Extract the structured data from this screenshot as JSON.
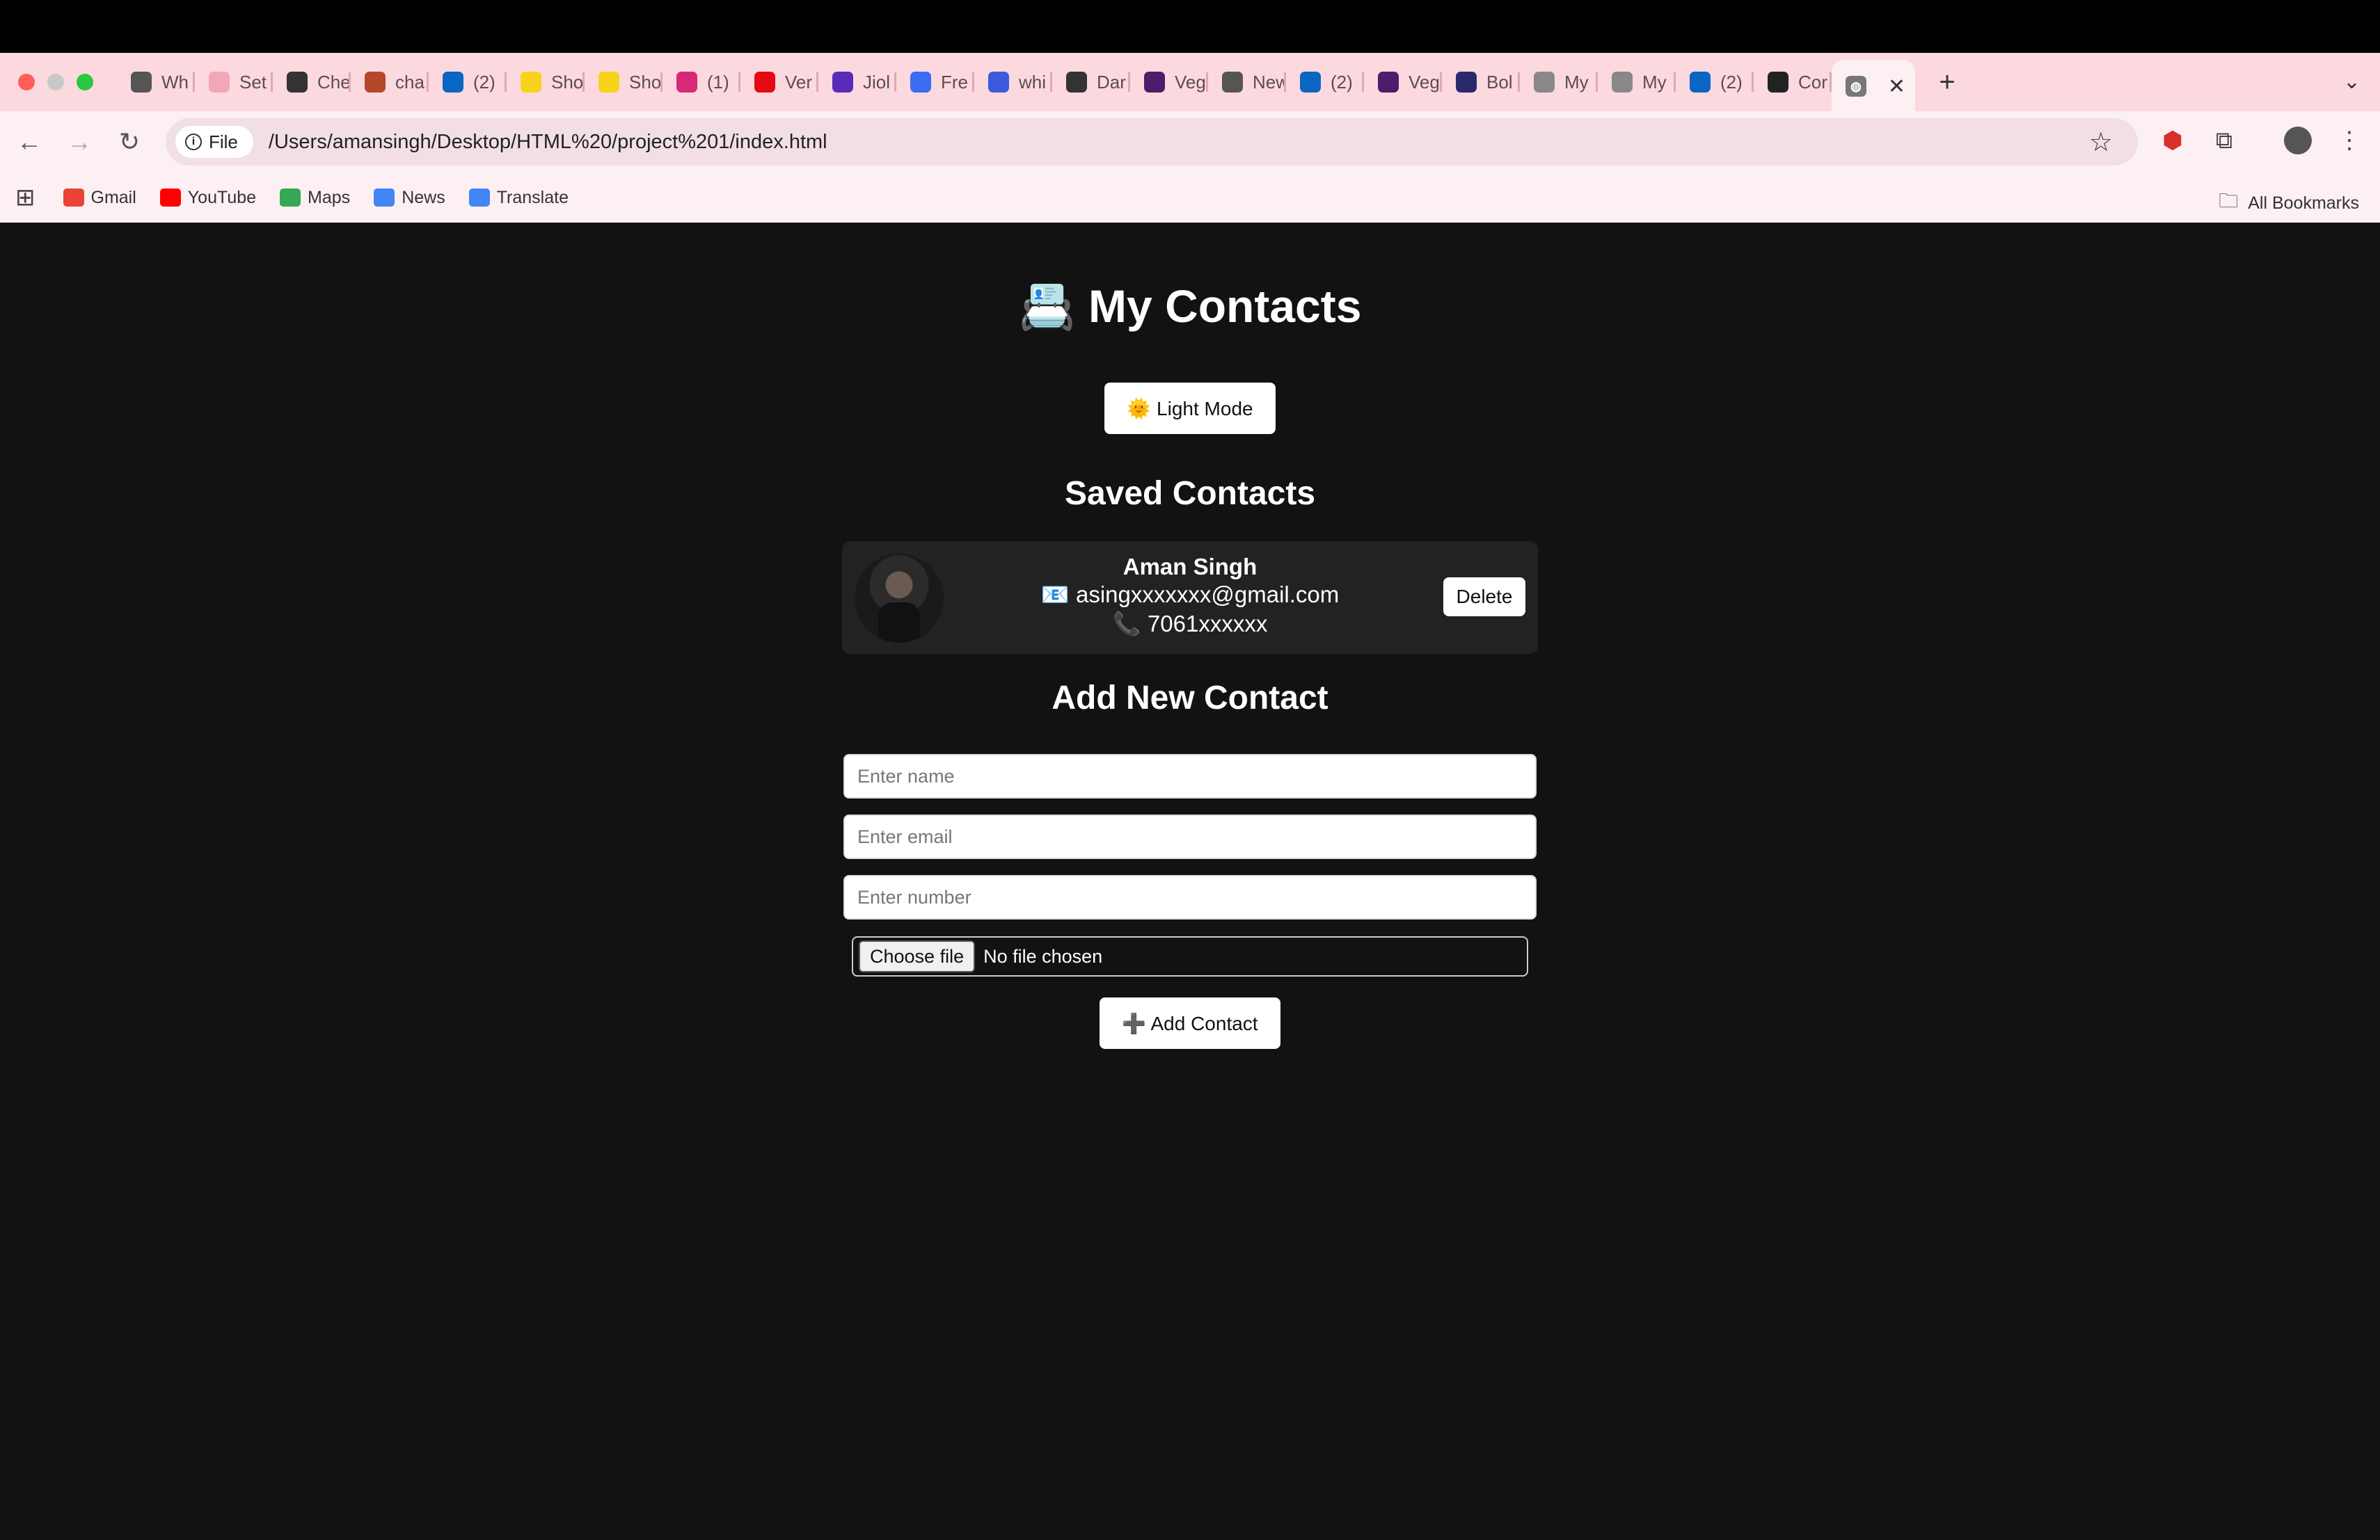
{
  "browser": {
    "tabs": [
      {
        "title": "Wh",
        "icon": "chrome-icon",
        "color": "#555555"
      },
      {
        "title": "Set",
        "icon": "settings-icon",
        "color": "#f1a7b5"
      },
      {
        "title": "Che",
        "icon": "claude-icon",
        "color": "#333333"
      },
      {
        "title": "cha",
        "icon": "chat-icon",
        "color": "#b5472a"
      },
      {
        "title": "(2)",
        "icon": "linkedin-icon",
        "color": "#0a66c2"
      },
      {
        "title": "Sho",
        "icon": "flipkart-icon",
        "color": "#f7d31c"
      },
      {
        "title": "Sho",
        "icon": "flipkart-icon",
        "color": "#f7d31c"
      },
      {
        "title": "(1)",
        "icon": "instagram-icon",
        "color": "#d62976"
      },
      {
        "title": "Ver",
        "icon": "netflix-icon",
        "color": "#e50914"
      },
      {
        "title": "Jiol",
        "icon": "jio-icon",
        "color": "#5a2ab8"
      },
      {
        "title": "Fre",
        "icon": "freecodecamp-icon",
        "color": "#3b6cf1"
      },
      {
        "title": "whi",
        "icon": "printer-icon",
        "color": "#3b5bdb"
      },
      {
        "title": "Dar",
        "icon": "openai-icon",
        "color": "#333333"
      },
      {
        "title": "Veg",
        "icon": "vercel-icon",
        "color": "#4b1d6b"
      },
      {
        "title": "New",
        "icon": "chrome-icon",
        "color": "#555555"
      },
      {
        "title": "(2)",
        "icon": "linkedin-icon",
        "color": "#0a66c2"
      },
      {
        "title": "Veg",
        "icon": "vercel-icon",
        "color": "#4b1d6b"
      },
      {
        "title": "Bol",
        "icon": "bolt-icon",
        "color": "#2a2a6a"
      },
      {
        "title": "My",
        "icon": "globe-icon",
        "color": "#888888"
      },
      {
        "title": "My",
        "icon": "globe-icon",
        "color": "#888888"
      },
      {
        "title": "(2)",
        "icon": "linkedin-icon",
        "color": "#0a66c2"
      },
      {
        "title": "Cor",
        "icon": "github-icon",
        "color": "#222222"
      }
    ],
    "active_tab": {
      "icon": "globe-icon",
      "close": "✕"
    },
    "new_tab": "+",
    "omnibox": {
      "chip_label": "File",
      "url": "/Users/amansingh/Desktop/HTML%20/project%201/index.html"
    },
    "bookmarks": [
      {
        "label": "Gmail",
        "icon": "gmail-icon",
        "color": "#ea4335"
      },
      {
        "label": "YouTube",
        "icon": "youtube-icon",
        "color": "#ff0000"
      },
      {
        "label": "Maps",
        "icon": "maps-icon",
        "color": "#34a853"
      },
      {
        "label": "News",
        "icon": "news-icon",
        "color": "#4285f4"
      },
      {
        "label": "Translate",
        "icon": "translate-icon",
        "color": "#4285f4"
      }
    ],
    "all_bookmarks": "All Bookmarks"
  },
  "app": {
    "title": "📇 My Contacts",
    "theme_toggle": "🌞 Light Mode",
    "saved_heading": "Saved Contacts",
    "contacts": [
      {
        "name": "Aman Singh",
        "email": "📧 asingxxxxxxx@gmail.com",
        "phone": "📞 7061xxxxxx",
        "delete_label": "Delete"
      }
    ],
    "add_heading": "Add New Contact",
    "form": {
      "name_placeholder": "Enter name",
      "email_placeholder": "Enter email",
      "number_placeholder": "Enter number",
      "file_button": "Choose file",
      "file_status": "No file chosen",
      "submit_label": "➕ Add Contact"
    }
  },
  "colors": {
    "page_bg": "#121212",
    "card_bg": "#222222",
    "tabstrip_bg": "#fbd9df"
  }
}
